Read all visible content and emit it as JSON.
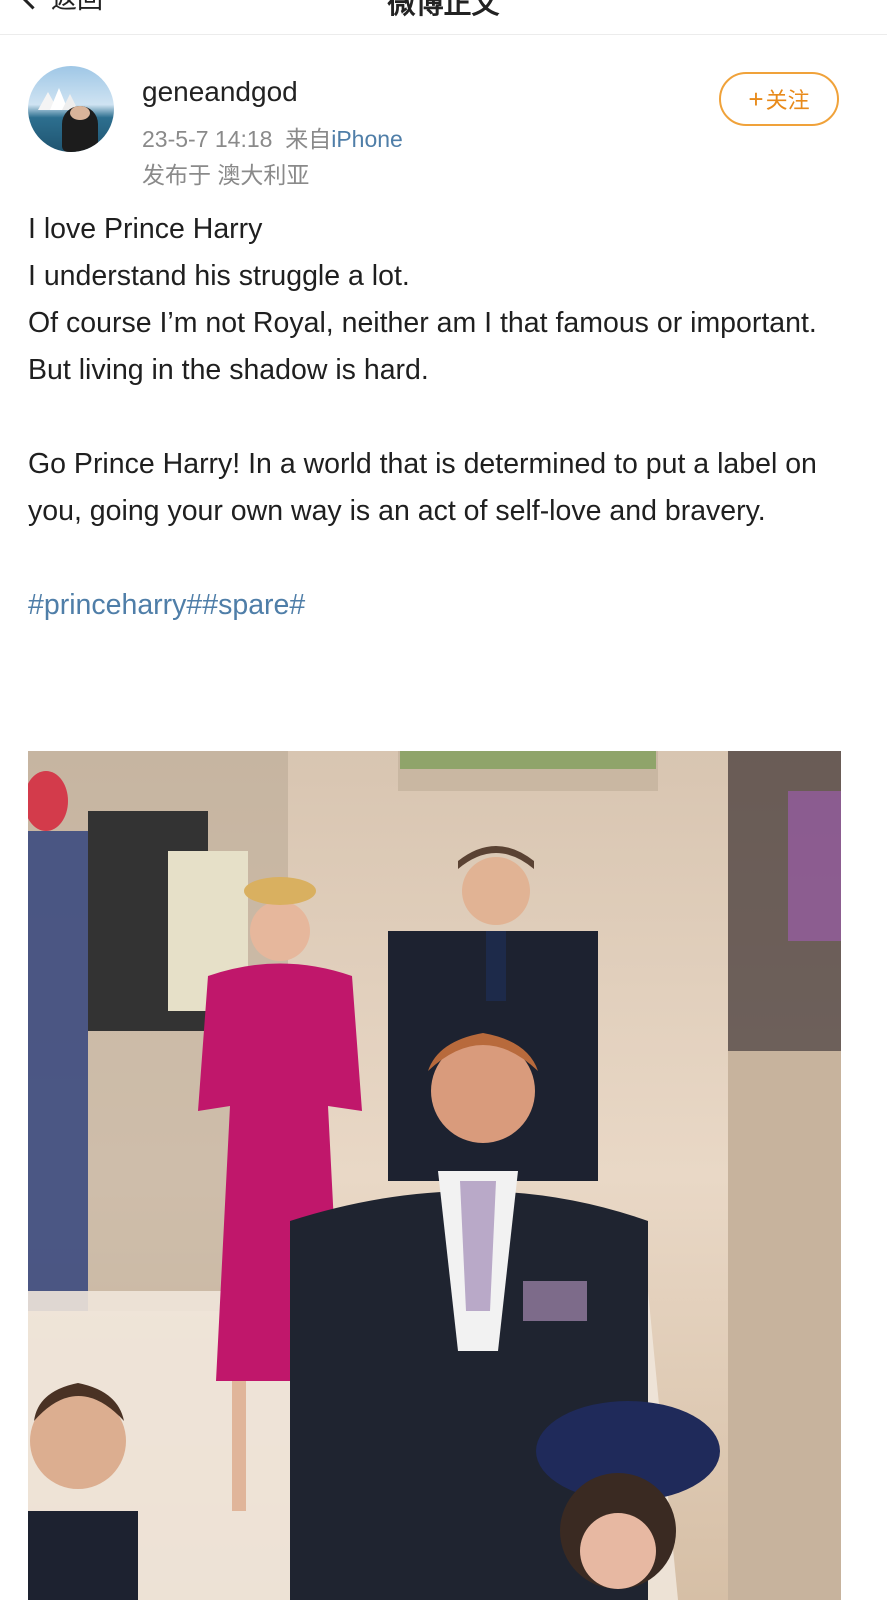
{
  "nav": {
    "back_label": "返回",
    "title": "微博正文"
  },
  "post": {
    "username": "geneandgod",
    "timestamp": "23-5-7 14:18",
    "source_prefix": "来自",
    "source": "iPhone",
    "location": "发布于 澳大利亚",
    "follow_label": "关注",
    "lines": [
      "I love Prince Harry",
      "I understand his struggle a lot.",
      "Of course I’m not Royal, neither am I that famous or important.",
      "But living in the shadow is hard."
    ],
    "paragraph2": "Go Prince Harry! In a world that is determined to put a label on you, going your own way is an act of self-love and bravery.",
    "hashtags": "#princeharry##spare#"
  },
  "icons": {
    "back": "chevron-left-icon",
    "follow": "plus-icon"
  },
  "colors": {
    "link": "#4f7ea8",
    "follow_accent": "#f0a23a",
    "meta_text": "#8a8a8a"
  }
}
